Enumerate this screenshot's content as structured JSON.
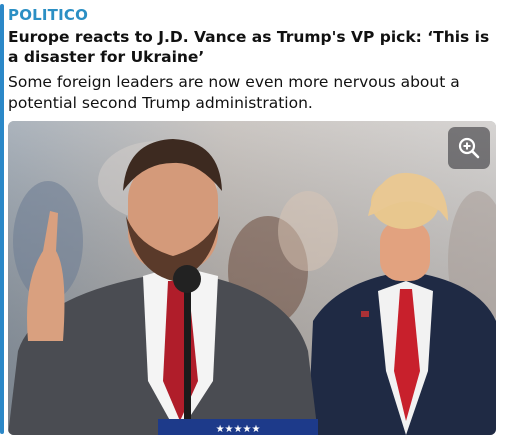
{
  "link_preview": {
    "site_name": "POLITICO",
    "title": "Europe reacts to J.D. Vance as Trump's VP pick: ‘This is a disaster for Ukraine’",
    "description": "Some foreign leaders are now even more nervous about a potential second Trump administration.",
    "accent_color": "#2b88c8",
    "site_color": "#2b8fc4",
    "image": {
      "zoom_icon": "zoom-in-icon",
      "podium_stars": "★★★★★"
    }
  }
}
